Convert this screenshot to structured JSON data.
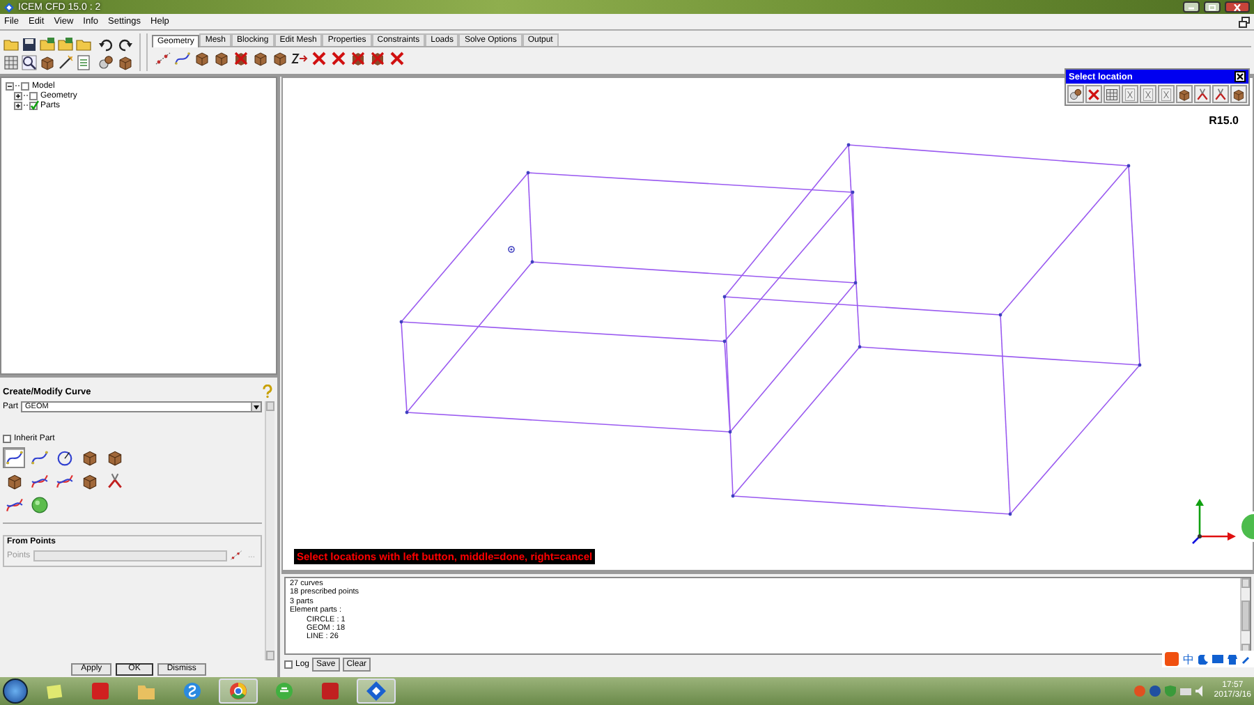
{
  "window": {
    "title": "ICEM CFD 15.0 : 2"
  },
  "menu": [
    "File",
    "Edit",
    "View",
    "Info",
    "Settings",
    "Help"
  ],
  "tabs": [
    {
      "label": "Geometry",
      "selected": true
    },
    {
      "label": "Mesh",
      "selected": false
    },
    {
      "label": "Blocking",
      "selected": false
    },
    {
      "label": "Edit Mesh",
      "selected": false
    },
    {
      "label": "Properties",
      "selected": false
    },
    {
      "label": "Constraints",
      "selected": false
    },
    {
      "label": "Loads",
      "selected": false
    },
    {
      "label": "Solve Options",
      "selected": false
    },
    {
      "label": "Output",
      "selected": false
    }
  ],
  "tree": [
    {
      "label": "Model",
      "expanded": true,
      "checked": false,
      "children": [
        {
          "label": "Geometry",
          "expanded": false,
          "checked": false
        },
        {
          "label": "Parts",
          "expanded": false,
          "checked": true
        }
      ]
    }
  ],
  "panel": {
    "title": "Create/Modify Curve",
    "part_label": "Part",
    "part_value": "GEOM",
    "inherit_part": {
      "label": "Inherit Part",
      "checked": false
    },
    "tool_buttons": [
      {
        "selected": true
      },
      {
        "selected": false
      },
      {
        "selected": false
      },
      {
        "selected": false
      },
      {
        "selected": false
      },
      {
        "selected": false
      },
      {
        "selected": false
      },
      {
        "selected": false
      },
      {
        "selected": false
      },
      {
        "selected": false
      },
      {
        "selected": false
      },
      {
        "selected": false
      }
    ],
    "section": {
      "title": "From Points",
      "field_label": "Points",
      "disabled": true,
      "more": "..."
    },
    "buttons": [
      "Apply",
      "OK",
      "Dismiss"
    ]
  },
  "viewport": {
    "version": "R15.0",
    "message": "Select locations with left button, middle=done, right=cancel",
    "select_location": {
      "title": "Select location"
    }
  },
  "console": {
    "lines": [
      {
        "text": "27 curves"
      },
      {
        "text": "18 prescribed points"
      },
      {
        "text": "3 parts"
      },
      {
        "text": "Element parts :",
        "children": [
          {
            "text": "CIRCLE : 1"
          },
          {
            "text": "GEOM : 18"
          },
          {
            "text": "LINE : 26"
          }
        ]
      }
    ],
    "log": {
      "label": "Log",
      "checked": false
    },
    "buttons": [
      "Save",
      "Clear"
    ]
  },
  "taskbar": {
    "ime": "中",
    "time": "17:57",
    "date": "2017/3/16"
  }
}
